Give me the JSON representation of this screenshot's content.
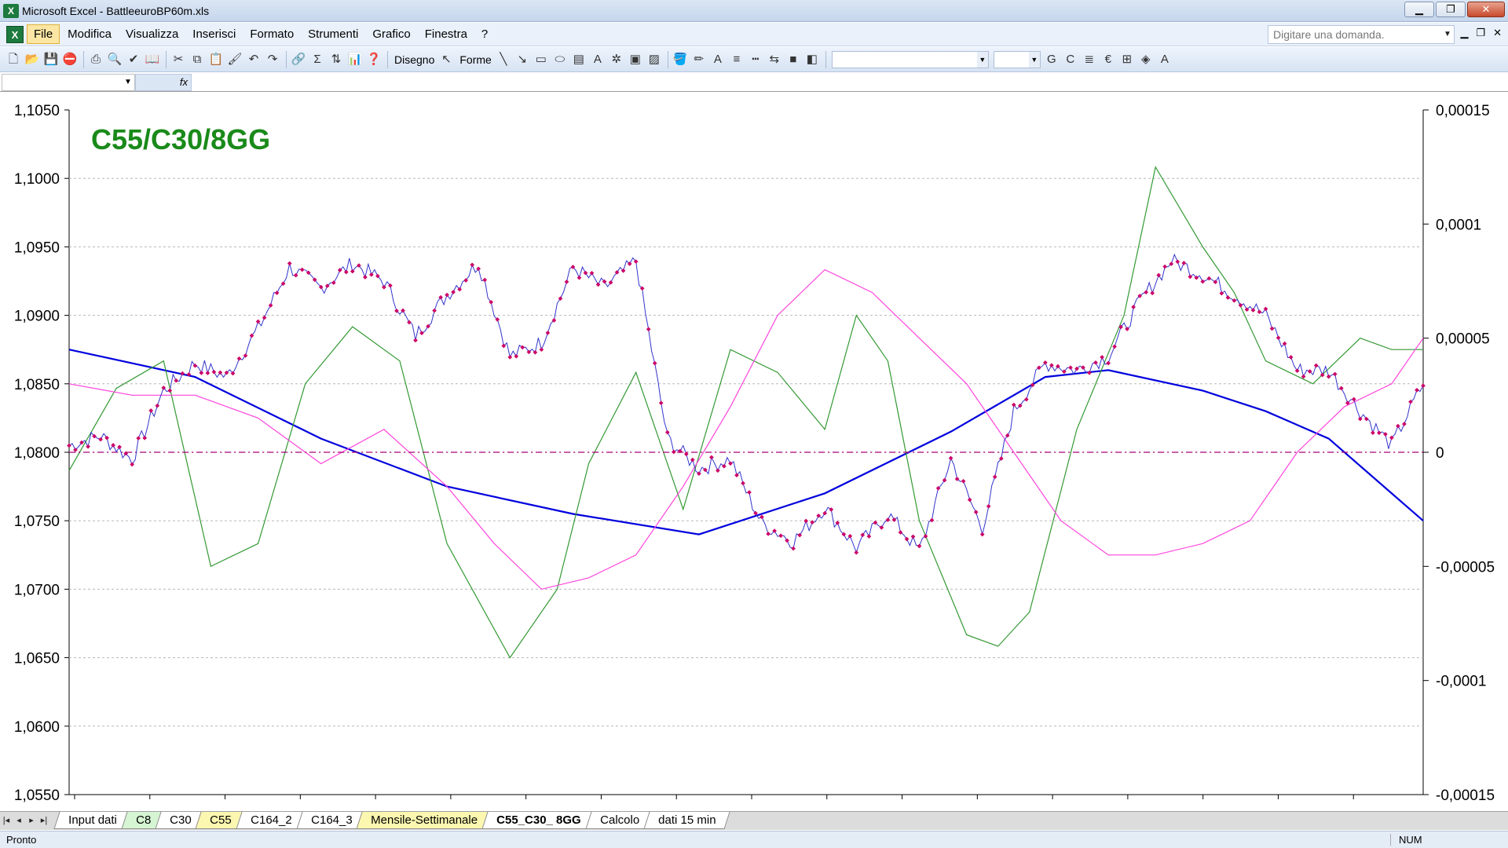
{
  "window": {
    "title": "Microsoft Excel - BattleeuroBP60m.xls",
    "controls": [
      "▁",
      "❐",
      "✕"
    ]
  },
  "menu": {
    "items": [
      "File",
      "Modifica",
      "Visualizza",
      "Inserisci",
      "Formato",
      "Strumenti",
      "Grafico",
      "Finestra",
      "?"
    ],
    "help_placeholder": "Digitare una domanda.",
    "doc_controls": [
      "▁",
      "❐",
      "✕"
    ]
  },
  "toolbar": {
    "disegno": "Disegno",
    "forme": "Forme",
    "bold": "G",
    "italic": "C"
  },
  "tabs": [
    "Input dati",
    "C8",
    "C30",
    "C55",
    "C164_2",
    "C164_3",
    "Mensile-Settimanale",
    "C55_C30_ 8GG",
    "Calcolo",
    "dati 15 min"
  ],
  "status": {
    "left": "Pronto",
    "num": "NUM"
  },
  "colors": {
    "price": "#3333cc",
    "marker": "#cc0066",
    "blue_ma": "#0000dd",
    "green": "#339933",
    "magenta": "#ff44dd",
    "zero_line": "#aa0077",
    "title": "#1a8a1a"
  },
  "chart_data": {
    "type": "line",
    "title": "C55/C30/8GG",
    "left_axis": {
      "ylim": [
        1.055,
        1.105
      ],
      "ticks": [
        "1,1050",
        "1,1000",
        "1,0950",
        "1,0900",
        "1,0850",
        "1,0800",
        "1,0750",
        "1,0700",
        "1,0650",
        "1,0600",
        "1,0550"
      ]
    },
    "right_axis": {
      "ylim": [
        -0.00015,
        0.00015
      ],
      "ticks": [
        "0,00015",
        "0,0001",
        "0,00005",
        "0",
        "-0,00005",
        "-0,0001",
        "-0,00015"
      ]
    },
    "x_count": 430,
    "series": [
      {
        "axis": "left",
        "key": "price",
        "markers": true,
        "x": [
          0,
          10,
          20,
          30,
          40,
          50,
          60,
          70,
          80,
          90,
          100,
          110,
          120,
          130,
          140,
          150,
          160,
          170,
          180,
          190,
          200,
          210,
          220,
          230,
          240,
          250,
          260,
          270,
          280,
          290,
          300,
          310,
          320,
          330,
          340,
          350,
          360,
          370,
          380,
          390,
          400,
          410,
          420,
          430
        ],
        "values": [
          1.0805,
          1.0812,
          1.0795,
          1.0845,
          1.0865,
          1.0855,
          1.089,
          1.0935,
          1.092,
          1.0938,
          1.0925,
          1.0885,
          1.0915,
          1.0938,
          1.087,
          1.088,
          1.0935,
          1.092,
          1.094,
          1.081,
          1.0788,
          1.0795,
          1.0748,
          1.0735,
          1.076,
          1.073,
          1.0755,
          1.0728,
          1.0795,
          1.0745,
          1.083,
          1.0865,
          1.086,
          1.087,
          1.091,
          1.094,
          1.093,
          1.0915,
          1.09,
          1.086,
          1.086,
          1.083,
          1.0805,
          1.085
        ]
      },
      {
        "axis": "left",
        "key": "blue_ma",
        "x": [
          0,
          40,
          80,
          120,
          160,
          200,
          240,
          280,
          310,
          330,
          360,
          380,
          400,
          430
        ],
        "values": [
          1.0875,
          1.0855,
          1.081,
          1.0775,
          1.0755,
          1.074,
          1.077,
          1.0815,
          1.0855,
          1.086,
          1.0845,
          1.083,
          1.081,
          1.075
        ]
      },
      {
        "axis": "right",
        "key": "green",
        "x": [
          0,
          15,
          30,
          45,
          60,
          75,
          90,
          105,
          120,
          140,
          155,
          165,
          180,
          195,
          210,
          225,
          240,
          250,
          260,
          270,
          285,
          295,
          305,
          320,
          335,
          345,
          360,
          370,
          380,
          395,
          410,
          420,
          430
        ],
        "values": [
          -8e-06,
          2.8e-05,
          4e-05,
          -5e-05,
          -4e-05,
          3e-05,
          5.5e-05,
          4e-05,
          -4e-05,
          -9e-05,
          -6e-05,
          -5e-06,
          3.5e-05,
          -2.5e-05,
          4.5e-05,
          3.5e-05,
          1e-05,
          6e-05,
          4e-05,
          -3e-05,
          -8e-05,
          -8.5e-05,
          -7e-05,
          1e-05,
          6e-05,
          0.000125,
          9e-05,
          7e-05,
          4e-05,
          3e-05,
          5e-05,
          4.5e-05,
          4.5e-05
        ]
      },
      {
        "axis": "right",
        "key": "magenta",
        "x": [
          0,
          20,
          40,
          60,
          80,
          100,
          120,
          135,
          150,
          165,
          180,
          195,
          210,
          225,
          240,
          255,
          270,
          285,
          300,
          315,
          330,
          345,
          360,
          375,
          390,
          405,
          420,
          430
        ],
        "values": [
          3e-05,
          2.5e-05,
          2.5e-05,
          1.5e-05,
          -5e-06,
          1e-05,
          -1.5e-05,
          -4e-05,
          -6e-05,
          -5.5e-05,
          -4.5e-05,
          -1.5e-05,
          2e-05,
          6e-05,
          8e-05,
          7e-05,
          5e-05,
          3e-05,
          0.0,
          -3e-05,
          -4.5e-05,
          -4.5e-05,
          -4e-05,
          -3e-05,
          0.0,
          2e-05,
          3e-05,
          5e-05
        ]
      },
      {
        "axis": "right",
        "key": "zero_line",
        "x": [
          0,
          430
        ],
        "values": [
          0,
          0
        ]
      }
    ]
  }
}
